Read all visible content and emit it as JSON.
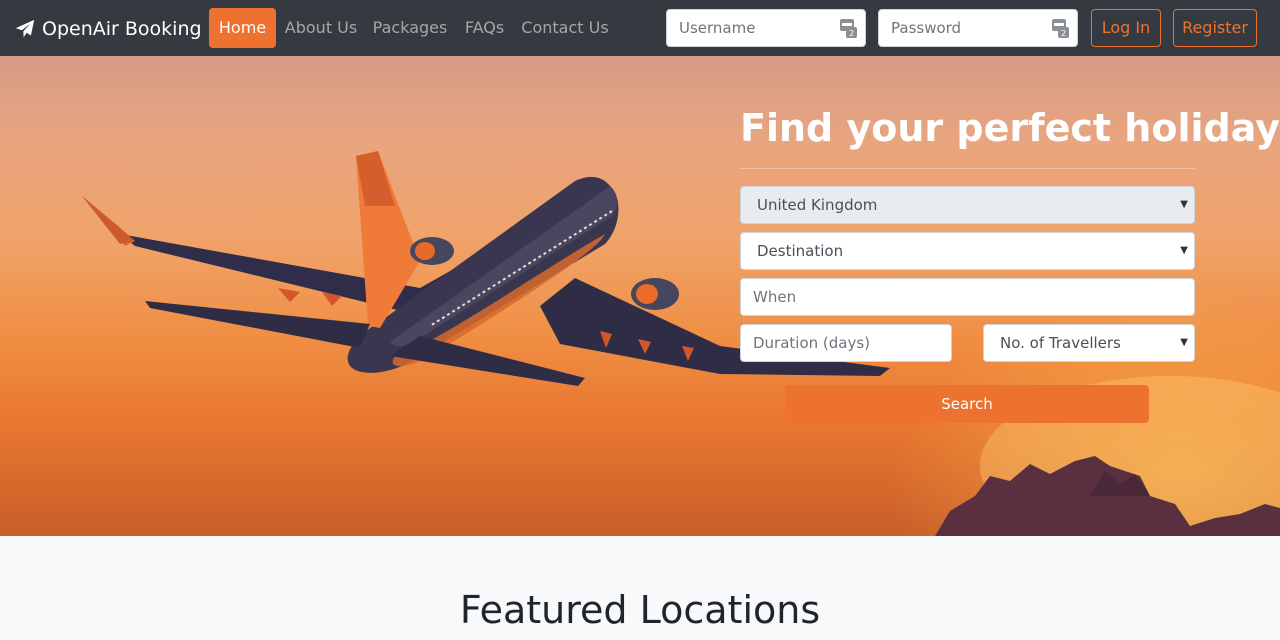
{
  "navbar": {
    "brand": "OpenAir Booking",
    "links": [
      {
        "label": "Home",
        "active": true
      },
      {
        "label": "About Us",
        "active": false
      },
      {
        "label": "Packages",
        "active": false
      },
      {
        "label": "FAQs",
        "active": false
      },
      {
        "label": "Contact Us",
        "active": false
      }
    ],
    "username_placeholder": "Username",
    "password_placeholder": "Password",
    "login_label": "Log In",
    "register_label": "Register"
  },
  "hero": {
    "title": "Find your perfect holiday",
    "origin_value": "United Kingdom",
    "destination_value": "Destination",
    "when_placeholder": "When",
    "duration_placeholder": "Duration (days)",
    "travellers_value": "No. of Travellers",
    "search_label": "Search"
  },
  "featured": {
    "title": "Featured Locations"
  },
  "colors": {
    "accent": "#ed7230",
    "navbar": "#343a40"
  },
  "icons": {
    "brand": "paper-plane-icon",
    "password_manager": "key-icon",
    "dropdown": "caret-down-icon"
  }
}
